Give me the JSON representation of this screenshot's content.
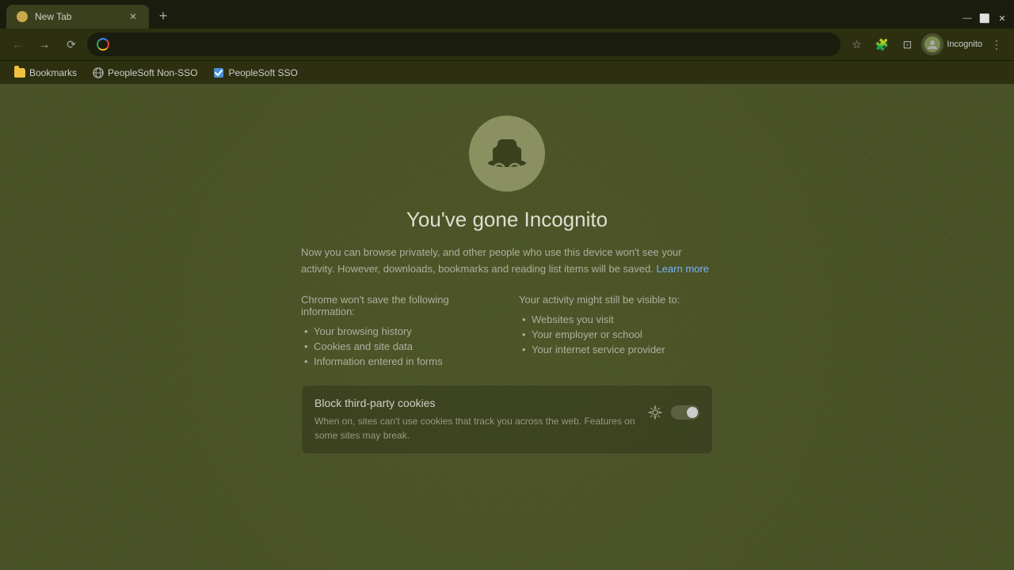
{
  "browser": {
    "tab": {
      "title": "New Tab",
      "favicon": "new-tab-favicon"
    },
    "address": "",
    "profile_name": "Incognito",
    "bookmarks": [
      {
        "label": "Bookmarks",
        "type": "folder"
      },
      {
        "label": "PeopleSoft Non-SSO",
        "type": "link"
      },
      {
        "label": "PeopleSoft SSO",
        "type": "link"
      }
    ]
  },
  "incognito": {
    "title": "You've gone Incognito",
    "description": "Now you can browse privately, and other people who use this device won't see your activity. However, downloads, bookmarks and reading list items will be saved.",
    "learn_more_text": "Learn more",
    "chrome_wont_save": {
      "title": "Chrome won't save the following information:",
      "items": [
        "Your browsing history",
        "Cookies and site data",
        "Information entered in forms"
      ]
    },
    "activity_visible": {
      "title": "Your activity might still be visible to:",
      "items": [
        "Websites you visit",
        "Your employer or school",
        "Your internet service provider"
      ]
    },
    "cookies_box": {
      "title": "Block third-party cookies",
      "description": "When on, sites can't use cookies that track you across the web. Features on some sites may break."
    }
  }
}
